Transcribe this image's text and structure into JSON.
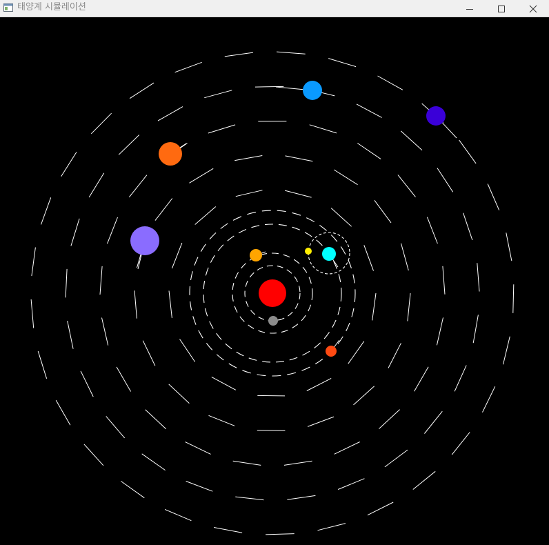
{
  "window": {
    "title": "태양계 시뮬레이션",
    "controls": [
      "minimize",
      "maximize",
      "close"
    ],
    "icons": {
      "app": "app-window-icon",
      "minimize": "minimize-icon",
      "maximize": "maximize-icon",
      "close": "close-icon"
    }
  },
  "scene": {
    "background": "#000000",
    "sun": {
      "name": "sun",
      "color": "#ff0000"
    },
    "bodies": [
      {
        "name": "moon",
        "color": "#8c8c8c"
      },
      {
        "name": "planet-gold",
        "color": "#ffa500"
      },
      {
        "name": "planet-yellow",
        "color": "#ffee00"
      },
      {
        "name": "planet-cyan",
        "color": "#00ffff"
      },
      {
        "name": "planet-red-orange",
        "color": "#ff4a12"
      },
      {
        "name": "planet-lavender",
        "color": "#8a6cff"
      },
      {
        "name": "planet-orange",
        "color": "#ff6a10"
      },
      {
        "name": "planet-sky-blue",
        "color": "#0a9aff"
      },
      {
        "name": "planet-indigo",
        "color": "#3a00d8"
      }
    ],
    "orbit_color": "#ffffff"
  }
}
